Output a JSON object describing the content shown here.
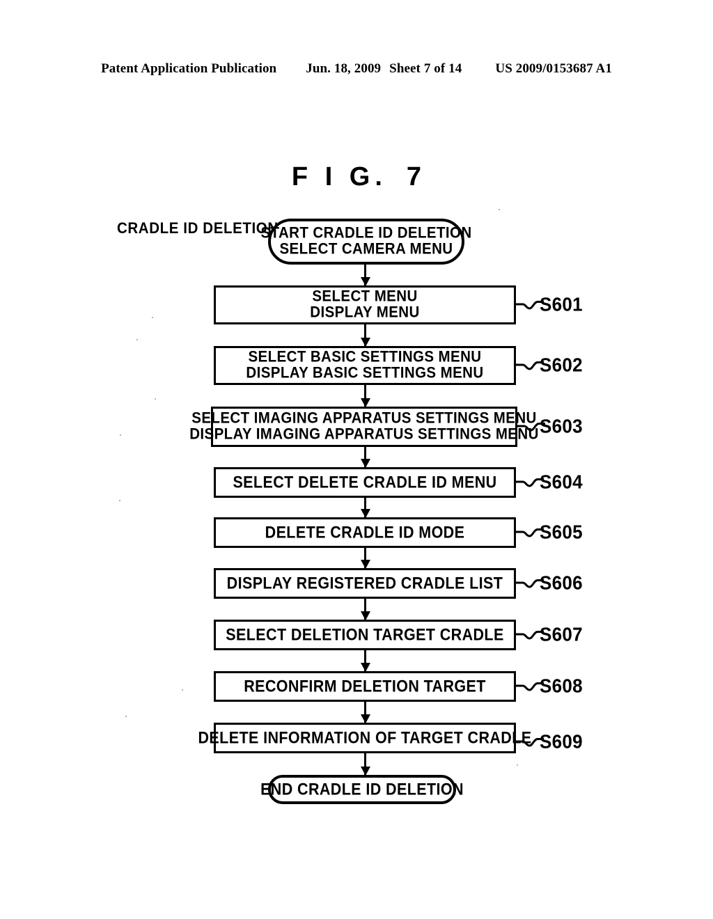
{
  "header": {
    "publication": "Patent Application Publication",
    "date": "Jun. 18, 2009",
    "sheet": "Sheet 7 of 14",
    "number": "US 2009/0153687 A1"
  },
  "figure": {
    "label": "F I G.",
    "number": "7",
    "side_caption": "CRADLE ID DELETION"
  },
  "flowchart": {
    "type": "flowchart",
    "orientation": "vertical",
    "start": {
      "shape": "terminal",
      "lines": [
        "START CRADLE ID DELETION",
        "SELECT CAMERA MENU"
      ]
    },
    "end": {
      "shape": "terminal",
      "lines": [
        "END CRADLE ID DELETION"
      ]
    },
    "steps": [
      {
        "id": "S601",
        "shape": "process",
        "lines": [
          "SELECT MENU",
          "DISPLAY MENU"
        ]
      },
      {
        "id": "S602",
        "shape": "process",
        "lines": [
          "SELECT BASIC SETTINGS MENU",
          "DISPLAY BASIC SETTINGS MENU"
        ]
      },
      {
        "id": "S603",
        "shape": "process",
        "lines": [
          "SELECT IMAGING APPARATUS SETTINGS MENU",
          "DISPLAY IMAGING APPARATUS SETTINGS MENU"
        ]
      },
      {
        "id": "S604",
        "shape": "process",
        "lines": [
          "SELECT DELETE CRADLE ID MENU"
        ]
      },
      {
        "id": "S605",
        "shape": "process",
        "lines": [
          "DELETE CRADLE ID MODE"
        ]
      },
      {
        "id": "S606",
        "shape": "process",
        "lines": [
          "DISPLAY REGISTERED CRADLE LIST"
        ]
      },
      {
        "id": "S607",
        "shape": "process",
        "lines": [
          "SELECT DELETION TARGET CRADLE"
        ]
      },
      {
        "id": "S608",
        "shape": "process",
        "lines": [
          "RECONFIRM DELETION TARGET"
        ]
      },
      {
        "id": "S609",
        "shape": "process",
        "lines": [
          "DELETE INFORMATION OF TARGET CRADLE"
        ]
      }
    ]
  }
}
